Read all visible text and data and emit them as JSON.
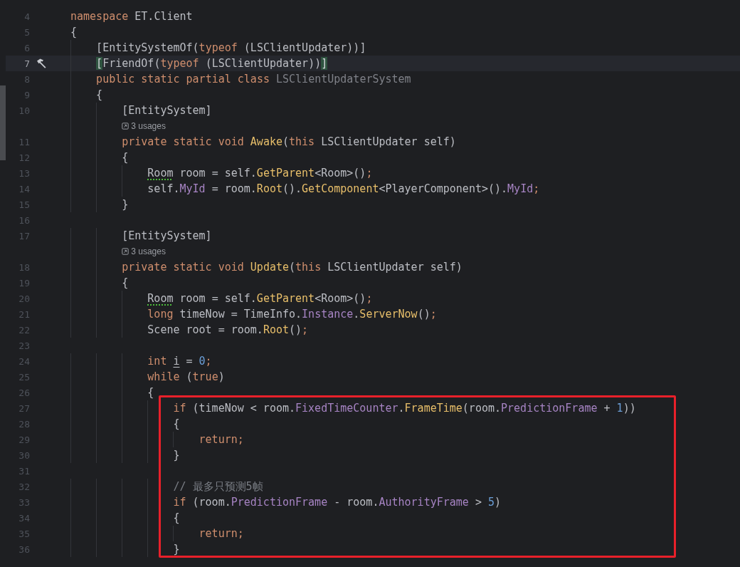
{
  "editor": {
    "lines": [
      {
        "kind": "code",
        "number": "4",
        "tokens": [
          {
            "text": "namespace",
            "kind": "keyword"
          },
          {
            "text": " ET.Client",
            "kind": "plain"
          }
        ]
      },
      {
        "kind": "code",
        "number": "5",
        "tokens": [
          {
            "text": "{",
            "kind": "plain"
          }
        ]
      },
      {
        "kind": "code",
        "number": "6",
        "tokens": [
          {
            "text": "    [EntitySystemOf(",
            "kind": "plain"
          },
          {
            "text": "typeof",
            "kind": "keyword"
          },
          {
            "text": " (LSClientUpdater))]",
            "kind": "plain"
          }
        ]
      },
      {
        "kind": "code",
        "number": "7",
        "current": true,
        "gutter_mark": true,
        "tokens": [
          {
            "text": "    [",
            "kind": "match"
          },
          {
            "text": "FriendOf(",
            "kind": "plain"
          },
          {
            "text": "typeof",
            "kind": "keyword"
          },
          {
            "text": " (LSClientUpdater))",
            "kind": "plain"
          },
          {
            "text": "]",
            "kind": "match"
          }
        ]
      },
      {
        "kind": "code",
        "number": "8",
        "tokens": [
          {
            "text": "    public static partial class ",
            "kind": "keyword"
          },
          {
            "text": "LSClientUpdaterSystem",
            "kind": "unused"
          }
        ]
      },
      {
        "kind": "code",
        "number": "9",
        "tokens": [
          {
            "text": "    {",
            "kind": "plain"
          }
        ]
      },
      {
        "kind": "code",
        "number": "10",
        "tokens": [
          {
            "text": "        [EntitySystem]",
            "kind": "plain"
          }
        ]
      },
      {
        "kind": "hint",
        "text": "3 usages"
      },
      {
        "kind": "code",
        "number": "11",
        "tokens": [
          {
            "text": "        private static void ",
            "kind": "keyword"
          },
          {
            "text": "Awake",
            "kind": "method"
          },
          {
            "text": "(",
            "kind": "plain"
          },
          {
            "text": "this",
            "kind": "keyword"
          },
          {
            "text": " LSClientUpdater self)",
            "kind": "plain"
          }
        ]
      },
      {
        "kind": "code",
        "number": "12",
        "tokens": [
          {
            "text": "        {",
            "kind": "plain"
          }
        ]
      },
      {
        "kind": "code",
        "number": "13",
        "tokens": [
          {
            "text": "            Room",
            "kind": "typo"
          },
          {
            "text": " room = self.",
            "kind": "plain"
          },
          {
            "text": "GetParent",
            "kind": "method"
          },
          {
            "text": "<Room>()",
            "kind": "plain"
          },
          {
            "text": ";",
            "kind": "keyword"
          }
        ]
      },
      {
        "kind": "code",
        "number": "14",
        "tokens": [
          {
            "text": "            self.",
            "kind": "plain"
          },
          {
            "text": "MyId",
            "kind": "field"
          },
          {
            "text": " = room.",
            "kind": "plain"
          },
          {
            "text": "Root",
            "kind": "method"
          },
          {
            "text": "().",
            "kind": "plain"
          },
          {
            "text": "GetComponent",
            "kind": "method"
          },
          {
            "text": "<PlayerComponent>().",
            "kind": "plain"
          },
          {
            "text": "MyId",
            "kind": "field"
          },
          {
            "text": ";",
            "kind": "keyword"
          }
        ]
      },
      {
        "kind": "code",
        "number": "15",
        "tokens": [
          {
            "text": "        }",
            "kind": "plain"
          }
        ]
      },
      {
        "kind": "code",
        "number": "16"
      },
      {
        "kind": "code",
        "number": "17",
        "tokens": [
          {
            "text": "        [EntitySystem]",
            "kind": "plain"
          }
        ]
      },
      {
        "kind": "hint",
        "text": "3 usages"
      },
      {
        "kind": "code",
        "number": "18",
        "tokens": [
          {
            "text": "        private static void ",
            "kind": "keyword"
          },
          {
            "text": "Update",
            "kind": "method"
          },
          {
            "text": "(",
            "kind": "plain"
          },
          {
            "text": "this",
            "kind": "keyword"
          },
          {
            "text": " LSClientUpdater self)",
            "kind": "plain"
          }
        ]
      },
      {
        "kind": "code",
        "number": "19",
        "tokens": [
          {
            "text": "        {",
            "kind": "plain"
          }
        ]
      },
      {
        "kind": "code",
        "number": "20",
        "tokens": [
          {
            "text": "            Room",
            "kind": "typo"
          },
          {
            "text": " room = self.",
            "kind": "plain"
          },
          {
            "text": "GetParent",
            "kind": "method"
          },
          {
            "text": "<Room>()",
            "kind": "plain"
          },
          {
            "text": ";",
            "kind": "keyword"
          }
        ]
      },
      {
        "kind": "code",
        "number": "21",
        "tokens": [
          {
            "text": "            long",
            "kind": "keyword"
          },
          {
            "text": " timeNow = TimeInfo.",
            "kind": "plain"
          },
          {
            "text": "Instance",
            "kind": "field"
          },
          {
            "text": ".",
            "kind": "plain"
          },
          {
            "text": "ServerNow",
            "kind": "method"
          },
          {
            "text": "()",
            "kind": "plain"
          },
          {
            "text": ";",
            "kind": "keyword"
          }
        ]
      },
      {
        "kind": "code",
        "number": "22",
        "tokens": [
          {
            "text": "            Scene root = room.",
            "kind": "plain"
          },
          {
            "text": "Root",
            "kind": "method"
          },
          {
            "text": "()",
            "kind": "plain"
          },
          {
            "text": ";",
            "kind": "keyword"
          }
        ]
      },
      {
        "kind": "code",
        "number": "23"
      },
      {
        "kind": "code",
        "number": "24",
        "tokens": [
          {
            "text": "            int ",
            "kind": "keyword"
          },
          {
            "text": "i",
            "kind": "reassigned"
          },
          {
            "text": " = ",
            "kind": "plain"
          },
          {
            "text": "0",
            "kind": "number"
          },
          {
            "text": ";",
            "kind": "keyword"
          }
        ]
      },
      {
        "kind": "code",
        "number": "25",
        "tokens": [
          {
            "text": "            while",
            "kind": "keyword"
          },
          {
            "text": " (",
            "kind": "plain"
          },
          {
            "text": "true",
            "kind": "keyword"
          },
          {
            "text": ")",
            "kind": "plain"
          }
        ]
      },
      {
        "kind": "code",
        "number": "26",
        "tokens": [
          {
            "text": "            {",
            "kind": "plain"
          }
        ]
      },
      {
        "kind": "code",
        "number": "27",
        "boxed": true,
        "tokens": [
          {
            "text": "                if",
            "kind": "keyword"
          },
          {
            "text": " (timeNow < room.",
            "kind": "plain"
          },
          {
            "text": "FixedTimeCounter",
            "kind": "field"
          },
          {
            "text": ".",
            "kind": "plain"
          },
          {
            "text": "FrameTime",
            "kind": "method"
          },
          {
            "text": "(room.",
            "kind": "plain"
          },
          {
            "text": "PredictionFrame",
            "kind": "field"
          },
          {
            "text": " + ",
            "kind": "plain"
          },
          {
            "text": "1",
            "kind": "number"
          },
          {
            "text": "))",
            "kind": "plain"
          }
        ]
      },
      {
        "kind": "code",
        "number": "28",
        "boxed": true,
        "tokens": [
          {
            "text": "                {",
            "kind": "plain"
          }
        ]
      },
      {
        "kind": "code",
        "number": "29",
        "boxed": true,
        "tokens": [
          {
            "text": "                    return;",
            "kind": "keyword"
          }
        ]
      },
      {
        "kind": "code",
        "number": "30",
        "boxed": true,
        "tokens": [
          {
            "text": "                }",
            "kind": "plain"
          }
        ]
      },
      {
        "kind": "code",
        "number": "31",
        "boxed": true
      },
      {
        "kind": "code",
        "number": "32",
        "boxed": true,
        "tokens": [
          {
            "text": "                // 最多只预测5帧",
            "kind": "comment"
          }
        ]
      },
      {
        "kind": "code",
        "number": "33",
        "boxed": true,
        "tokens": [
          {
            "text": "                if",
            "kind": "keyword"
          },
          {
            "text": " (room.",
            "kind": "plain"
          },
          {
            "text": "PredictionFrame",
            "kind": "field"
          },
          {
            "text": " - room.",
            "kind": "plain"
          },
          {
            "text": "AuthorityFrame",
            "kind": "field"
          },
          {
            "text": " > ",
            "kind": "plain"
          },
          {
            "text": "5",
            "kind": "number"
          },
          {
            "text": ")",
            "kind": "plain"
          }
        ]
      },
      {
        "kind": "code",
        "number": "34",
        "boxed": true,
        "tokens": [
          {
            "text": "                {",
            "kind": "plain"
          }
        ]
      },
      {
        "kind": "code",
        "number": "35",
        "boxed": true,
        "tokens": [
          {
            "text": "                    return;",
            "kind": "keyword"
          }
        ]
      },
      {
        "kind": "code",
        "number": "36",
        "boxed": true,
        "tokens": [
          {
            "text": "                }",
            "kind": "plain"
          }
        ]
      }
    ]
  }
}
